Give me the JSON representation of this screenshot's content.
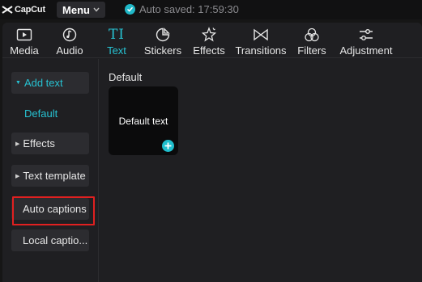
{
  "app": {
    "logo_text": "CapCut"
  },
  "header": {
    "menu_label": "Menu",
    "autosave_text": "Auto saved: 17:59:30"
  },
  "tabs": [
    {
      "label": "Media",
      "icon": "media-icon",
      "active": false
    },
    {
      "label": "Audio",
      "icon": "audio-icon",
      "active": false
    },
    {
      "label": "Text",
      "icon": "text-icon",
      "active": true
    },
    {
      "label": "Stickers",
      "icon": "stickers-icon",
      "active": false
    },
    {
      "label": "Effects",
      "icon": "effects-icon",
      "active": false
    },
    {
      "label": "Transitions",
      "icon": "transitions-icon",
      "active": false
    },
    {
      "label": "Filters",
      "icon": "filters-icon",
      "active": false
    },
    {
      "label": "Adjustment",
      "icon": "adjustment-icon",
      "active": false
    }
  ],
  "text_tab_icon_glyph": "TI",
  "sidebar": {
    "add_text": "Add text",
    "default": "Default",
    "effects": "Effects",
    "text_template": "Text template",
    "auto_captions": "Auto captions",
    "local_captions": "Local captio..."
  },
  "content": {
    "section_title": "Default",
    "card_label": "Default text"
  },
  "colors": {
    "accent": "#27c2d2",
    "highlight_border": "#e02020",
    "panel_bg": "#1f1f22"
  }
}
